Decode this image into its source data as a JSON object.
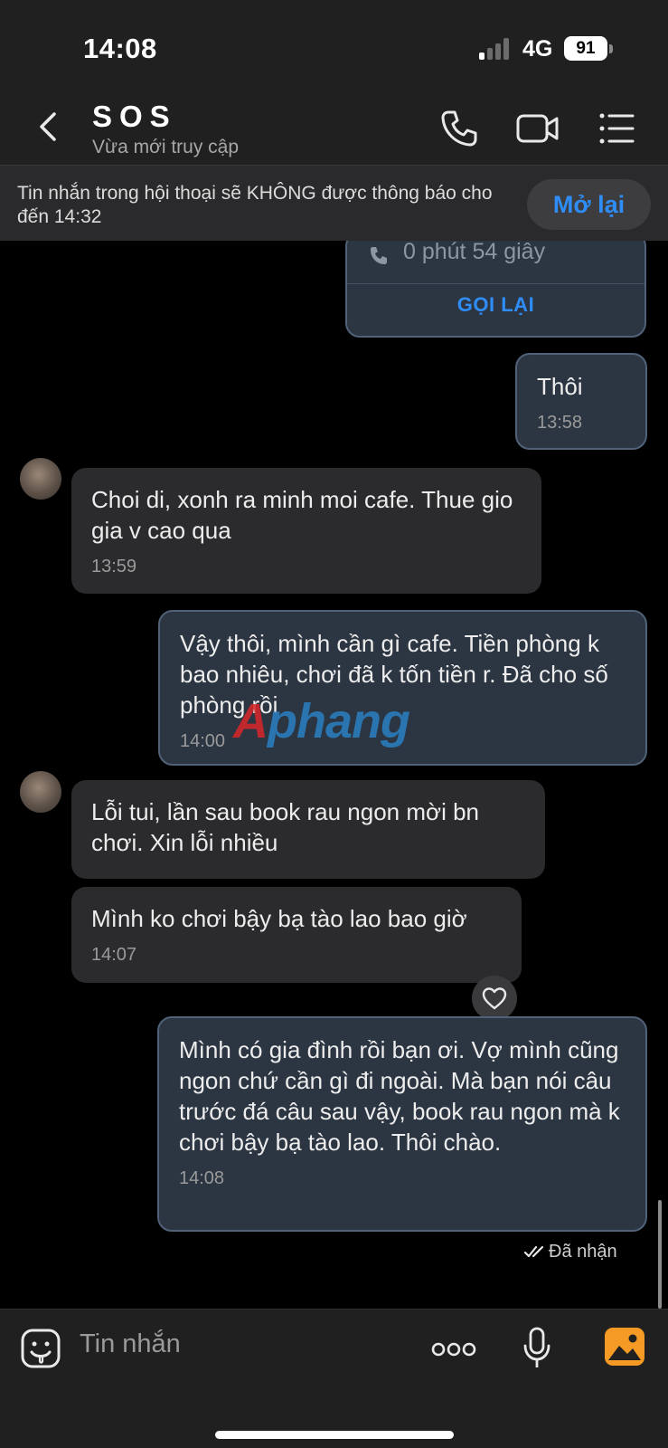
{
  "status": {
    "time": "14:08",
    "network": "4G",
    "battery": "91"
  },
  "header": {
    "title": "SOS",
    "subtitle": "Vừa mới truy cập"
  },
  "banner": {
    "text": "Tin nhắn trong hội thoại sẽ KHÔNG được thông báo cho đến 14:32",
    "button": "Mở lại"
  },
  "call": {
    "duration": "0 phút 54 giây",
    "callback": "GỌI LẠI"
  },
  "messages": [
    {
      "dir": "out",
      "text": "Thôi",
      "time": "13:58"
    },
    {
      "dir": "in",
      "text": "Choi di, xonh ra minh moi cafe. Thue gio gia v cao qua",
      "time": "13:59"
    },
    {
      "dir": "out",
      "text": "Vậy thôi, mình cần gì cafe. Tiền phòng k bao nhiêu, chơi đã k tốn tiền r. Đã cho số phòng rồi",
      "time": "14:00"
    },
    {
      "dir": "in",
      "text": "Lỗi tui, lần sau book rau ngon mời bn chơi. Xin lỗi nhiều",
      "time": ""
    },
    {
      "dir": "in",
      "text": "Mình ko chơi bậy bạ tào lao bao giờ",
      "time": "14:07"
    },
    {
      "dir": "out",
      "text": "Mình có gia đình rồi bạn ơi. Vợ mình cũng ngon chứ cần gì đi ngoài. Mà bạn nói câu trước đá câu sau vậy, book rau ngon mà k chơi bậy bạ tào lao. Thôi chào.",
      "time": "14:08"
    }
  ],
  "receipt": "Đã nhận",
  "watermark": {
    "a": "A",
    "rest": "phang"
  },
  "composer": {
    "placeholder": "Tin nhắn"
  },
  "colors": {
    "accent": "#2f8df7",
    "outgoing": "#2c3542",
    "incoming": "#2b2b2d"
  }
}
